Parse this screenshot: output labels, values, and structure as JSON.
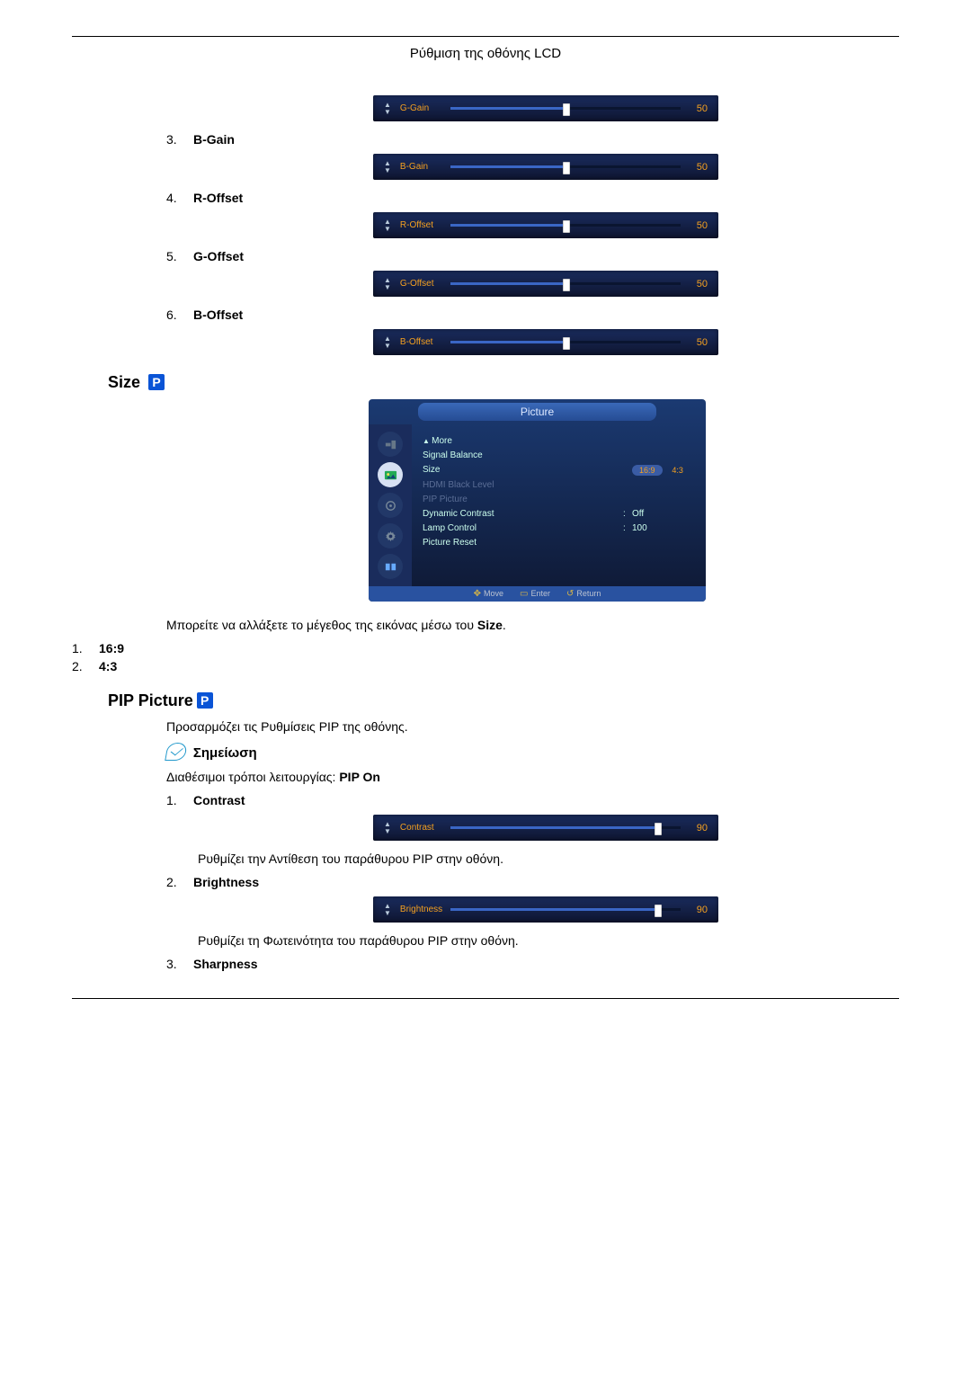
{
  "header": {
    "title": "Ρύθμιση της οθόνης LCD"
  },
  "sliders": [
    {
      "label": "G-Gain",
      "value": 50,
      "pct": 50,
      "li_num": "",
      "li_label": ""
    },
    {
      "label": "B-Gain",
      "value": 50,
      "pct": 50,
      "li_num": "3.",
      "li_label": "B-Gain"
    },
    {
      "label": "R-Offset",
      "value": 50,
      "pct": 50,
      "li_num": "4.",
      "li_label": "R-Offset"
    },
    {
      "label": "G-Offset",
      "value": 50,
      "pct": 50,
      "li_num": "5.",
      "li_label": "G-Offset"
    },
    {
      "label": "B-Offset",
      "value": 50,
      "pct": 50,
      "li_num": "6.",
      "li_label": "B-Offset"
    }
  ],
  "size": {
    "heading": "Size",
    "p_badge": "P",
    "menu_title": "Picture",
    "items": [
      {
        "key": "",
        "kicon": "▲ ",
        "klabel": "More",
        "val": "",
        "dis": false
      },
      {
        "key": "Signal Balance",
        "val": "",
        "dis": false
      },
      {
        "key": "Size",
        "val_badges": [
          "16:9",
          "4:3"
        ],
        "dis": false,
        "sel": 0
      },
      {
        "key": "HDMI Black Level",
        "val": "",
        "dis": true
      },
      {
        "key": "PIP Picture",
        "val": "",
        "dis": true
      },
      {
        "key": "Dynamic Contrast",
        "spacer": ":",
        "val": "Off",
        "dis": false
      },
      {
        "key": "Lamp Control",
        "spacer": ":",
        "val": "100",
        "dis": false
      },
      {
        "key": "Picture Reset",
        "val": "",
        "dis": false
      }
    ],
    "footer": {
      "move": "Move",
      "enter": "Enter",
      "return": "Return"
    },
    "desc": "Μπορείτε να αλλάξετε το μέγεθος της εικόνας μέσω του ",
    "desc_bold": "Size",
    "opts": [
      {
        "num": "1.",
        "label": "16:9"
      },
      {
        "num": "2.",
        "label": "4:3"
      }
    ]
  },
  "pip": {
    "heading": "PIP Picture",
    "p_badge": "P",
    "desc": "Προσαρμόζει τις Ρυθμίσεις PIP της οθόνης.",
    "note_label": "Σημείωση",
    "note_text_pre": "Διαθέσιμοι τρόποι λειτουργίας: ",
    "note_text_bold": "PIP On",
    "items": [
      {
        "num": "1.",
        "label": "Contrast",
        "slider": {
          "name": "Contrast",
          "value": 90,
          "pct": 90
        },
        "post": "Ρυθμίζει την Αντίθεση του παράθυρου PIP στην οθόνη."
      },
      {
        "num": "2.",
        "label": "Brightness",
        "slider": {
          "name": "Brightness",
          "value": 90,
          "pct": 90
        },
        "post": "Ρυθμίζει τη Φωτεινότητα του παράθυρου PIP στην οθόνη."
      },
      {
        "num": "3.",
        "label": "Sharpness",
        "slider": null,
        "post": ""
      }
    ]
  }
}
